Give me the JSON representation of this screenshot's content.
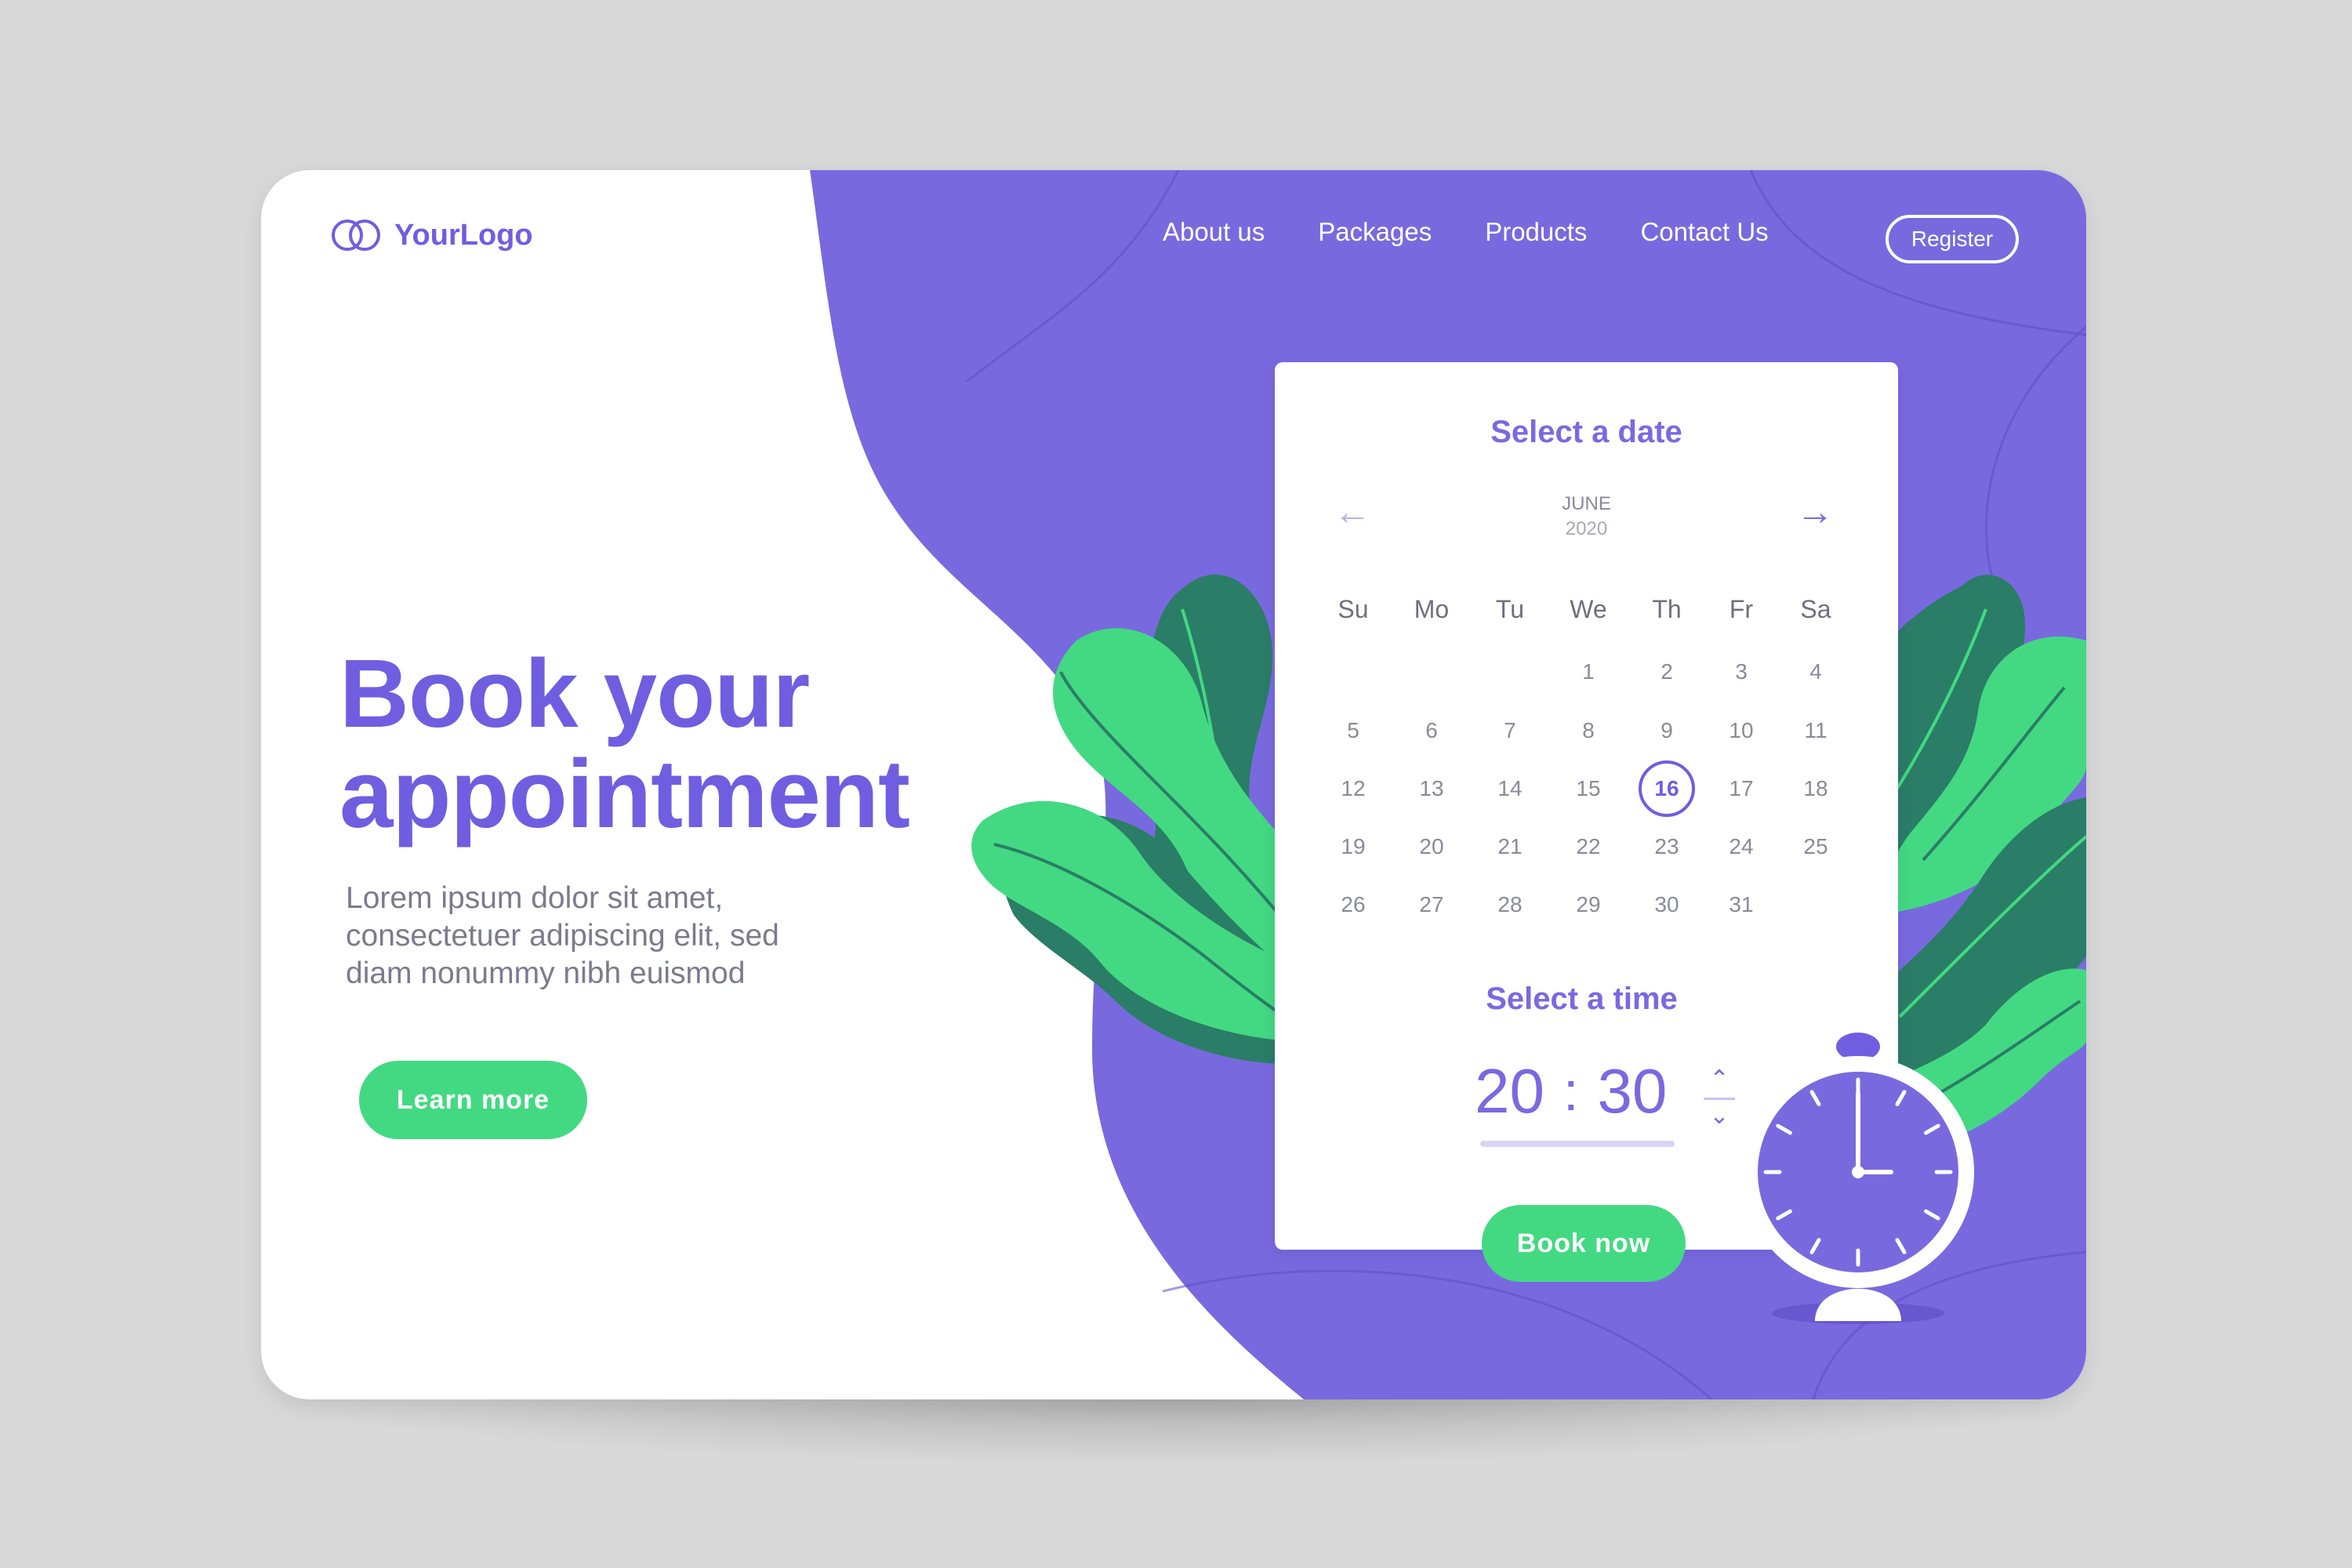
{
  "brand": {
    "logo_text": "YourLogo",
    "primary": "#7a69e0",
    "accent": "#43d982"
  },
  "nav": {
    "items": [
      {
        "label": "About us"
      },
      {
        "label": "Packages"
      },
      {
        "label": "Products"
      },
      {
        "label": "Contact Us"
      }
    ],
    "register_label": "Register"
  },
  "hero": {
    "title_line1": "Book your",
    "title_line2": "appointment",
    "text_line1": "Lorem ipsum dolor sit amet,",
    "text_line2": "consectetuer adipiscing elit, sed",
    "text_line3": "diam nonummy nibh euismod",
    "cta_label": "Learn more"
  },
  "booking": {
    "date_title": "Select a date",
    "month": "JUNE",
    "year": "2020",
    "weekdays": [
      "Su",
      "Mo",
      "Tu",
      "We",
      "Th",
      "Fr",
      "Sa"
    ],
    "days": [
      "1",
      "2",
      "3",
      "4",
      "5",
      "6",
      "7",
      "8",
      "9",
      "10",
      "11",
      "12",
      "13",
      "14",
      "15",
      "16",
      "17",
      "18",
      "19",
      "20",
      "21",
      "22",
      "23",
      "24",
      "25",
      "26",
      "27",
      "28",
      "29",
      "30",
      "31"
    ],
    "first_weekday_index": 3,
    "selected_day": "16",
    "time_title": "Select a time",
    "hours": "20",
    "separator": ":",
    "minutes": "30",
    "book_label": "Book now"
  },
  "icons": {
    "logo": "interlocking-rings-icon",
    "prev": "arrow-left-icon",
    "next": "arrow-right-icon",
    "up": "chevron-up-icon",
    "down": "chevron-down-icon",
    "clock": "alarm-clock-icon"
  }
}
